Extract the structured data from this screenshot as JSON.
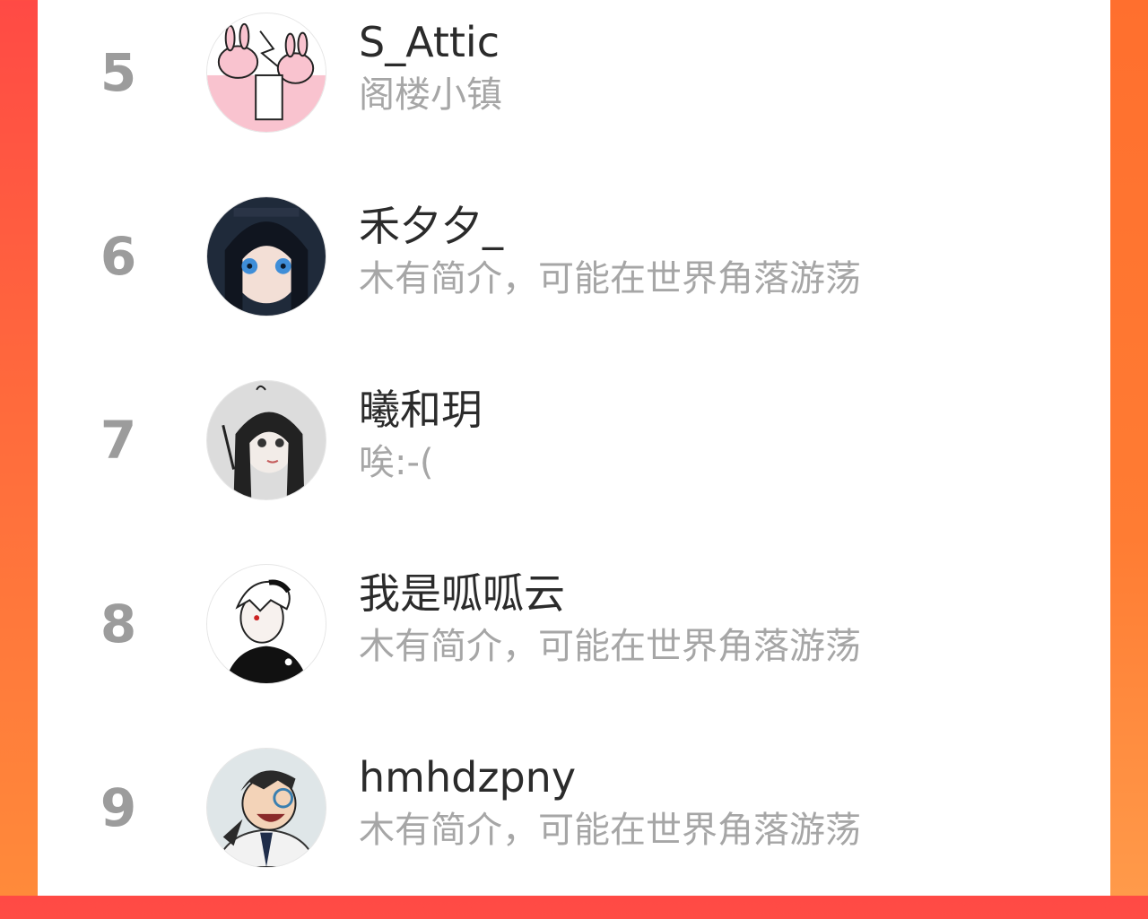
{
  "ranking": {
    "items": [
      {
        "rank": "5",
        "name": "S_Attic",
        "bio": "阁楼小镇",
        "avatar": "avatar-pink-rabbits"
      },
      {
        "rank": "6",
        "name": "禾夕夕_",
        "bio": "木有简介，可能在世界角落游荡",
        "avatar": "avatar-dark-haired-girl"
      },
      {
        "rank": "7",
        "name": "曦和玥",
        "bio": "唉:-(",
        "avatar": "avatar-monochrome-girl"
      },
      {
        "rank": "8",
        "name": "我是呱呱云",
        "bio": "木有简介，可能在世界角落游荡",
        "avatar": "avatar-white-haired-boy"
      },
      {
        "rank": "9",
        "name": "hmhdzpny",
        "bio": "木有简介，可能在世界角落游荡",
        "avatar": "avatar-laughing-boy"
      }
    ]
  },
  "colors": {
    "background_left": "#ff4a45",
    "background_right": "#ff7c33",
    "panel": "#ffffff",
    "rank_text": "#9c9c9c",
    "name_text": "#2b2b2b",
    "bio_text": "#a6a6a6"
  }
}
